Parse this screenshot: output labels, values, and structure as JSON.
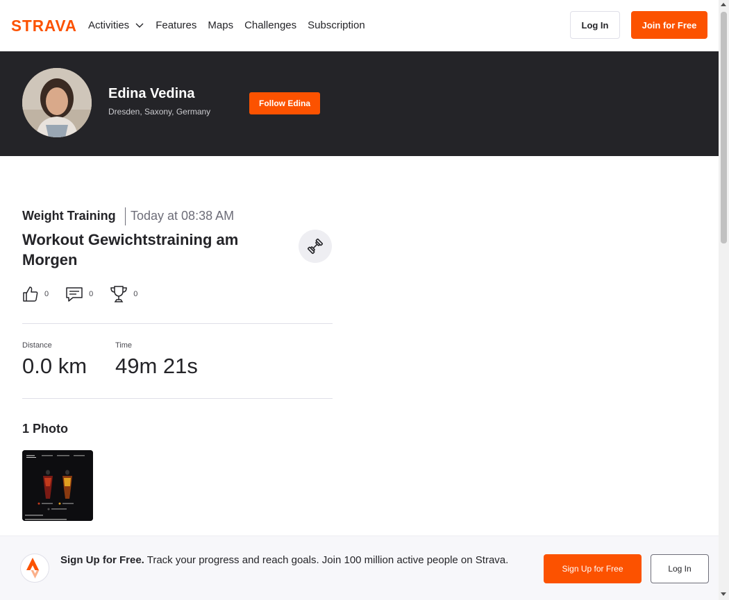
{
  "nav": {
    "logo_text": "STRAVA",
    "items": [
      {
        "label": "Activities",
        "has_dropdown": true
      },
      {
        "label": "Features"
      },
      {
        "label": "Maps"
      },
      {
        "label": "Challenges"
      },
      {
        "label": "Subscription"
      }
    ],
    "login_label": "Log In",
    "join_label": "Join for Free"
  },
  "athlete": {
    "name": "Edina Vedina",
    "location": "Dresden, Saxony, Germany",
    "follow_label": "Follow Edina"
  },
  "activity": {
    "type": "Weight Training",
    "time": "Today at 08:38 AM",
    "title": "Workout Gewichtstraining am Morgen",
    "sport_icon": "dumbbell-icon",
    "kudos_count": "0",
    "comments_count": "0",
    "achievements_count": "0",
    "stats": [
      {
        "label": "Distance",
        "value": "0.0 km"
      },
      {
        "label": "Time",
        "value": "49m 21s"
      }
    ],
    "photos_title": "1 Photo"
  },
  "banner": {
    "bold_text": "Sign Up for Free.",
    "text": " Track your progress and reach goals. Join 100 million active people on Strava.",
    "signup_label": "Sign Up for Free",
    "login_label": "Log In"
  },
  "colors": {
    "brand": "#fc5200",
    "dark": "#242428"
  }
}
